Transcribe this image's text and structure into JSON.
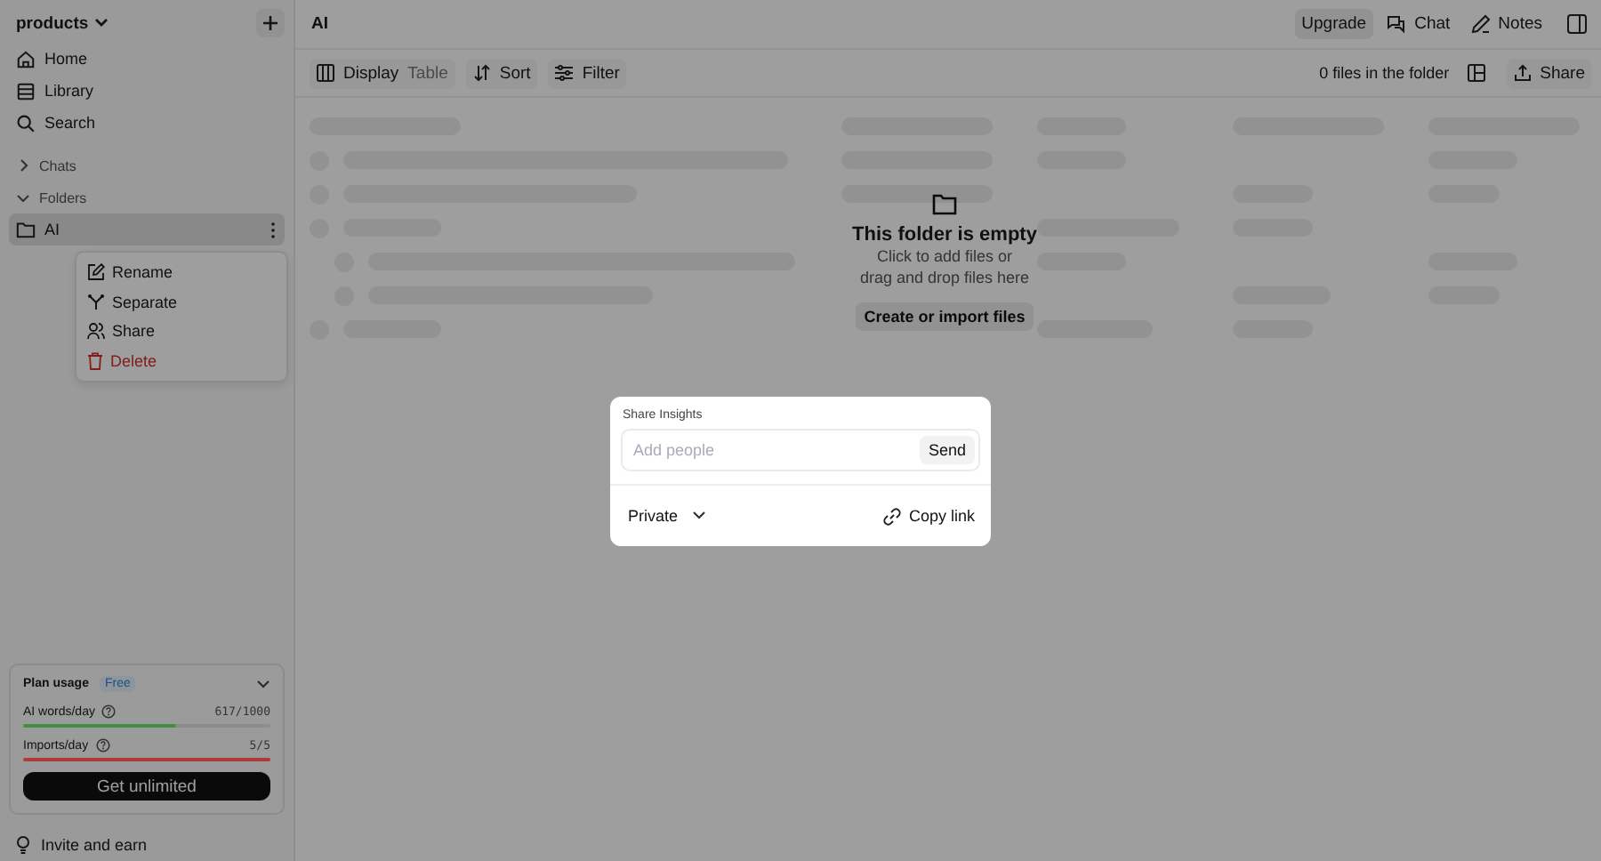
{
  "sidebar": {
    "workspace": "products",
    "nav": [
      {
        "label": "Home"
      },
      {
        "label": "Library"
      },
      {
        "label": "Search"
      }
    ],
    "sections": [
      {
        "label": "Chats",
        "expanded": false
      },
      {
        "label": "Folders",
        "expanded": true
      }
    ],
    "folders": [
      {
        "label": "AI",
        "selected": true
      }
    ],
    "context_menu": [
      {
        "label": "Rename",
        "kind": "normal"
      },
      {
        "label": "Separate",
        "kind": "normal"
      },
      {
        "label": "Share",
        "kind": "normal"
      },
      {
        "label": "Delete",
        "kind": "danger"
      }
    ],
    "plan": {
      "title": "Plan usage",
      "badge": "Free",
      "meters": [
        {
          "label": "AI words/day",
          "reading": "617/1000",
          "level": 0.617,
          "color": "#3f8f4a"
        },
        {
          "label": "Imports/day",
          "reading": "5/5",
          "level": 1,
          "color": "#b03a3a"
        }
      ],
      "button": "Get unlimited"
    },
    "footer": "Invite and earn"
  },
  "header": {
    "title": "AI",
    "actions": [
      {
        "label": "Upgrade"
      },
      {
        "label": "Chat"
      },
      {
        "label": "Notes"
      }
    ]
  },
  "toolbar": {
    "display": "Display",
    "display_value": "Table",
    "sort": "Sort",
    "filter": "Filter",
    "count": "0 files in the folder",
    "share": "Share"
  },
  "empty": {
    "title": "This folder is empty",
    "lines": [
      "Click to add files or",
      "drag and drop files here"
    ],
    "button": "Create or import files"
  },
  "dialog": {
    "title": "Share Insights",
    "input": {
      "placeholder": "Add people"
    },
    "send": "Send",
    "visibility": "Private",
    "copy": "Copy link"
  }
}
